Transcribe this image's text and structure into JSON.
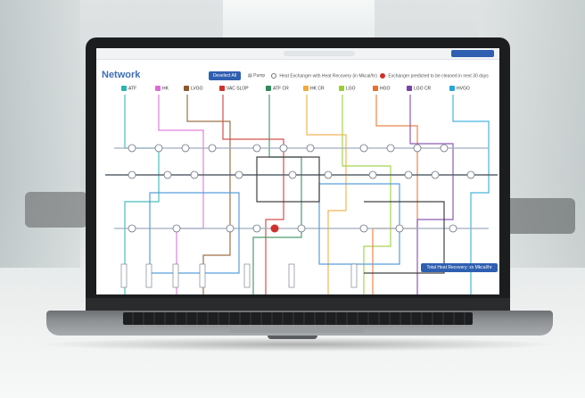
{
  "app": {
    "title": "Network",
    "deselect_label": "Deselect All",
    "total_button_label": "Total Heat Recovery: xx Mkcal/hr"
  },
  "legend": {
    "items": [
      {
        "label": "Pump",
        "icon": "pump-icon"
      },
      {
        "label": "Heat Exchanger with Heat Recovery (in Mkcal/hr)",
        "icon": "heat-exchanger-icon"
      },
      {
        "label": "Exchanger predicted to be cleaned in next 30 days",
        "icon": "alert-dot-icon",
        "color": "#d0312d"
      }
    ]
  },
  "streams": [
    {
      "label": "ATF",
      "color": "#2bb3b3"
    },
    {
      "label": "HK",
      "color": "#e06ad6"
    },
    {
      "label": "LVGO",
      "color": "#8a5a2b"
    },
    {
      "label": "VAC SLOP",
      "color": "#d0312d"
    },
    {
      "label": "ATF CR",
      "color": "#2e8b57"
    },
    {
      "label": "HK CR",
      "color": "#f2a93b"
    },
    {
      "label": "LGO",
      "color": "#9acd32"
    },
    {
      "label": "HGO",
      "color": "#e8702a"
    },
    {
      "label": "LGO CR",
      "color": "#7b3fa8"
    },
    {
      "label": "HVGO",
      "color": "#2aa6d6"
    }
  ],
  "colors": {
    "accent": "#2f5fb0",
    "title": "#3f6fb7",
    "alert": "#d0312d"
  }
}
